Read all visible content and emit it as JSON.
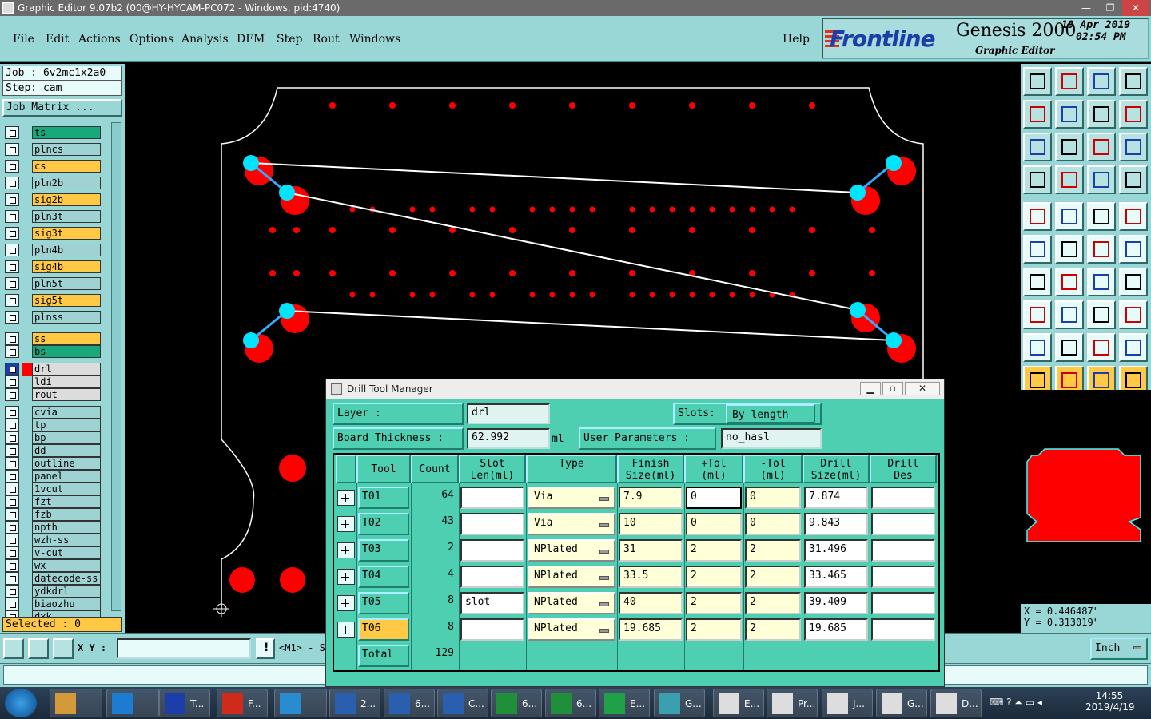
{
  "window": {
    "title": "Graphic Editor 9.07b2 (00@HY-HYCAM-PC072 - Windows, pid:4740)",
    "min": "—",
    "max": "❐",
    "close": "✕"
  },
  "menu": {
    "items": [
      "File",
      "Edit",
      "Actions",
      "Options",
      "Analysis",
      "DFM",
      "Step",
      "Rout",
      "Windows"
    ],
    "help": "Help"
  },
  "logo": {
    "brand": "Frontline",
    "product": "Genesis 2000",
    "sub": "Graphic Editor",
    "date": "19 Apr 2019",
    "time": "02:54 PM"
  },
  "left": {
    "job": "Job : 6v2mc1x2a0",
    "step": "Step: cam",
    "matrix_button": "Job Matrix ...",
    "selected": "Selected : 0",
    "layers": [
      {
        "name": "ts",
        "color": "g"
      },
      {
        "name": "plncs",
        "color": "c"
      },
      {
        "name": "cs",
        "color": "y"
      },
      {
        "name": "pln2b",
        "color": "c"
      },
      {
        "name": "sig2b",
        "color": "y"
      },
      {
        "name": "pln3t",
        "color": "c"
      },
      {
        "name": "sig3t",
        "color": "y"
      },
      {
        "name": "pln4b",
        "color": "c"
      },
      {
        "name": "sig4b",
        "color": "y"
      },
      {
        "name": "pln5t",
        "color": "c"
      },
      {
        "name": "sig5t",
        "color": "y"
      },
      {
        "name": "plnss",
        "color": "c"
      },
      {
        "name": "ss",
        "color": "y"
      },
      {
        "name": "bs",
        "color": "g"
      },
      {
        "name": "drl",
        "color": "w"
      },
      {
        "name": "ldi",
        "color": "w"
      },
      {
        "name": "rout",
        "color": "w"
      },
      {
        "name": "cvia",
        "color": "c"
      },
      {
        "name": "tp",
        "color": "c"
      },
      {
        "name": "bp",
        "color": "c"
      },
      {
        "name": "dd",
        "color": "c"
      },
      {
        "name": "outline",
        "color": "c"
      },
      {
        "name": "panel",
        "color": "c"
      },
      {
        "name": "1vcut",
        "color": "c"
      },
      {
        "name": "fzt",
        "color": "c"
      },
      {
        "name": "fzb",
        "color": "c"
      },
      {
        "name": "npth",
        "color": "c"
      },
      {
        "name": "wzh-ss",
        "color": "c"
      },
      {
        "name": "v-cut",
        "color": "c"
      },
      {
        "name": "wx",
        "color": "c"
      },
      {
        "name": "datecode-ss",
        "color": "c"
      },
      {
        "name": "ydkdrl",
        "color": "c"
      },
      {
        "name": "biaozhu",
        "color": "c"
      },
      {
        "name": "dxk",
        "color": "c"
      }
    ]
  },
  "right": {
    "coord_x": "X = 0.446487\"",
    "coord_y": "Y = 0.313019\""
  },
  "bottom": {
    "xy_label": "X Y :",
    "mode": "<M1> - S",
    "units": "Inch"
  },
  "dialog": {
    "title": "Drill Tool Manager",
    "layer_label": "Layer :",
    "layer_value": "drl",
    "slots_label": "Slots:",
    "slots_value": "By length",
    "thickness_label": "Board Thickness :",
    "thickness_value": "62.992",
    "thickness_unit": "ml",
    "userparams_label": "User Parameters :",
    "userparams_value": "no_hasl",
    "headers": [
      "Tool",
      "Count",
      "Slot\nLen(ml)",
      "Type",
      "Finish\nSize(ml)",
      "+Tol\n(ml)",
      "-Tol\n(ml)",
      "Drill\nSize(ml)",
      "Drill\nDes"
    ],
    "rows": [
      {
        "tool": "T01",
        "count": "64",
        "slot": "",
        "type": "Via",
        "finish": "7.9",
        "ptol": "0",
        "mtol": "0",
        "drill": "7.874",
        "des": ""
      },
      {
        "tool": "T02",
        "count": "43",
        "slot": "",
        "type": "Via",
        "finish": "10",
        "ptol": "0",
        "mtol": "0",
        "drill": "9.843",
        "des": ""
      },
      {
        "tool": "T03",
        "count": "2",
        "slot": "",
        "type": "NPlated",
        "finish": "31",
        "ptol": "2",
        "mtol": "2",
        "drill": "31.496",
        "des": ""
      },
      {
        "tool": "T04",
        "count": "4",
        "slot": "",
        "type": "NPlated",
        "finish": "33.5",
        "ptol": "2",
        "mtol": "2",
        "drill": "33.465",
        "des": ""
      },
      {
        "tool": "T05",
        "count": "8",
        "slot": "slot",
        "type": "NPlated",
        "finish": "40",
        "ptol": "2",
        "mtol": "2",
        "drill": "39.409",
        "des": ""
      },
      {
        "tool": "T06",
        "count": "8",
        "slot": "",
        "type": "NPlated",
        "finish": "19.685",
        "ptol": "2",
        "mtol": "2",
        "drill": "19.685",
        "des": ""
      }
    ],
    "total_label": "Total",
    "total_value": "129"
  },
  "taskbar": {
    "items": [
      "T...",
      "F...",
      "",
      "2...",
      "6...",
      "C...",
      "6...",
      "6...",
      "E...",
      "G...",
      "E...",
      "Pr...",
      "J...",
      "G...",
      "D..."
    ],
    "time": "14:55",
    "date": "2019/4/19"
  },
  "colors": {
    "panel": "#99d7d7",
    "dialog": "#4ecfb1",
    "pad": "#ff0000",
    "drill": "#00e5ff",
    "highlight": "#ffc845"
  }
}
